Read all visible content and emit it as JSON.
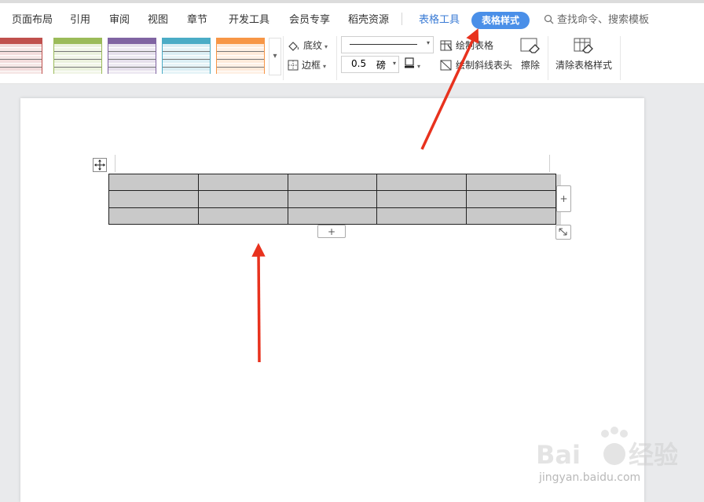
{
  "menu": {
    "items": [
      "页面布局",
      "引用",
      "审阅",
      "视图",
      "章节",
      "开发工具",
      "会员专享",
      "稻壳资源"
    ],
    "context_tab": "表格工具",
    "active_tab": "表格样式",
    "search": "查找命令、搜索模板"
  },
  "ribbon": {
    "shading_label": "底纹",
    "border_label": "边框",
    "line_weight_value": "0.5",
    "line_weight_unit": "磅",
    "draw_table_label": "绘制表格",
    "draw_diagonal_label": "绘制斜线表头",
    "erase_label": "擦除",
    "clear_style_label": "清除表格样式",
    "swatch_colors": [
      "#c0504d",
      "#9bbb59",
      "#8064a2",
      "#4bacc6",
      "#f79646"
    ]
  },
  "table": {
    "rows": 3,
    "cols": 5,
    "cell_fill": "#c9c9c9",
    "add_row_symbol": "+",
    "add_col_symbol": "+"
  },
  "annotation": {
    "arrow_color": "#e8321e"
  },
  "watermark": {
    "text": "jingyan.baidu.com"
  }
}
